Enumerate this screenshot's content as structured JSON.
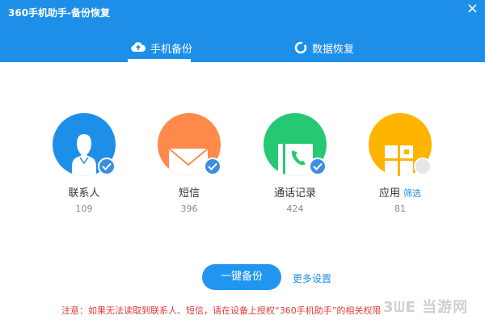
{
  "window": {
    "title": "360手机助手-备份恢复",
    "close_glyph": "×"
  },
  "tabs": [
    {
      "label": "手机备份",
      "icon": "cloud-upload-icon",
      "active": true
    },
    {
      "label": "数据恢复",
      "icon": "ring-icon",
      "active": false
    }
  ],
  "items": [
    {
      "label": "联系人",
      "count": "109",
      "color": "#1e8fe9",
      "icon": "person-icon",
      "checked": true
    },
    {
      "label": "短信",
      "count": "396",
      "color": "#ff8a4c",
      "icon": "envelope-icon",
      "checked": true
    },
    {
      "label": "通话记录",
      "count": "424",
      "color": "#27c874",
      "icon": "phone-book-icon",
      "checked": true
    },
    {
      "label": "应用",
      "count": "81",
      "color": "#ffb400",
      "icon": "apps-icon",
      "checked": false,
      "extra_link": "筛选"
    }
  ],
  "actions": {
    "backup_button": "一键备份",
    "more_settings": "更多设置"
  },
  "notice": "注意：如果无法读取到联系人、短信，请在设备上授权“360手机助手”的相关权限",
  "watermark": "3ᗯE 当游网"
}
